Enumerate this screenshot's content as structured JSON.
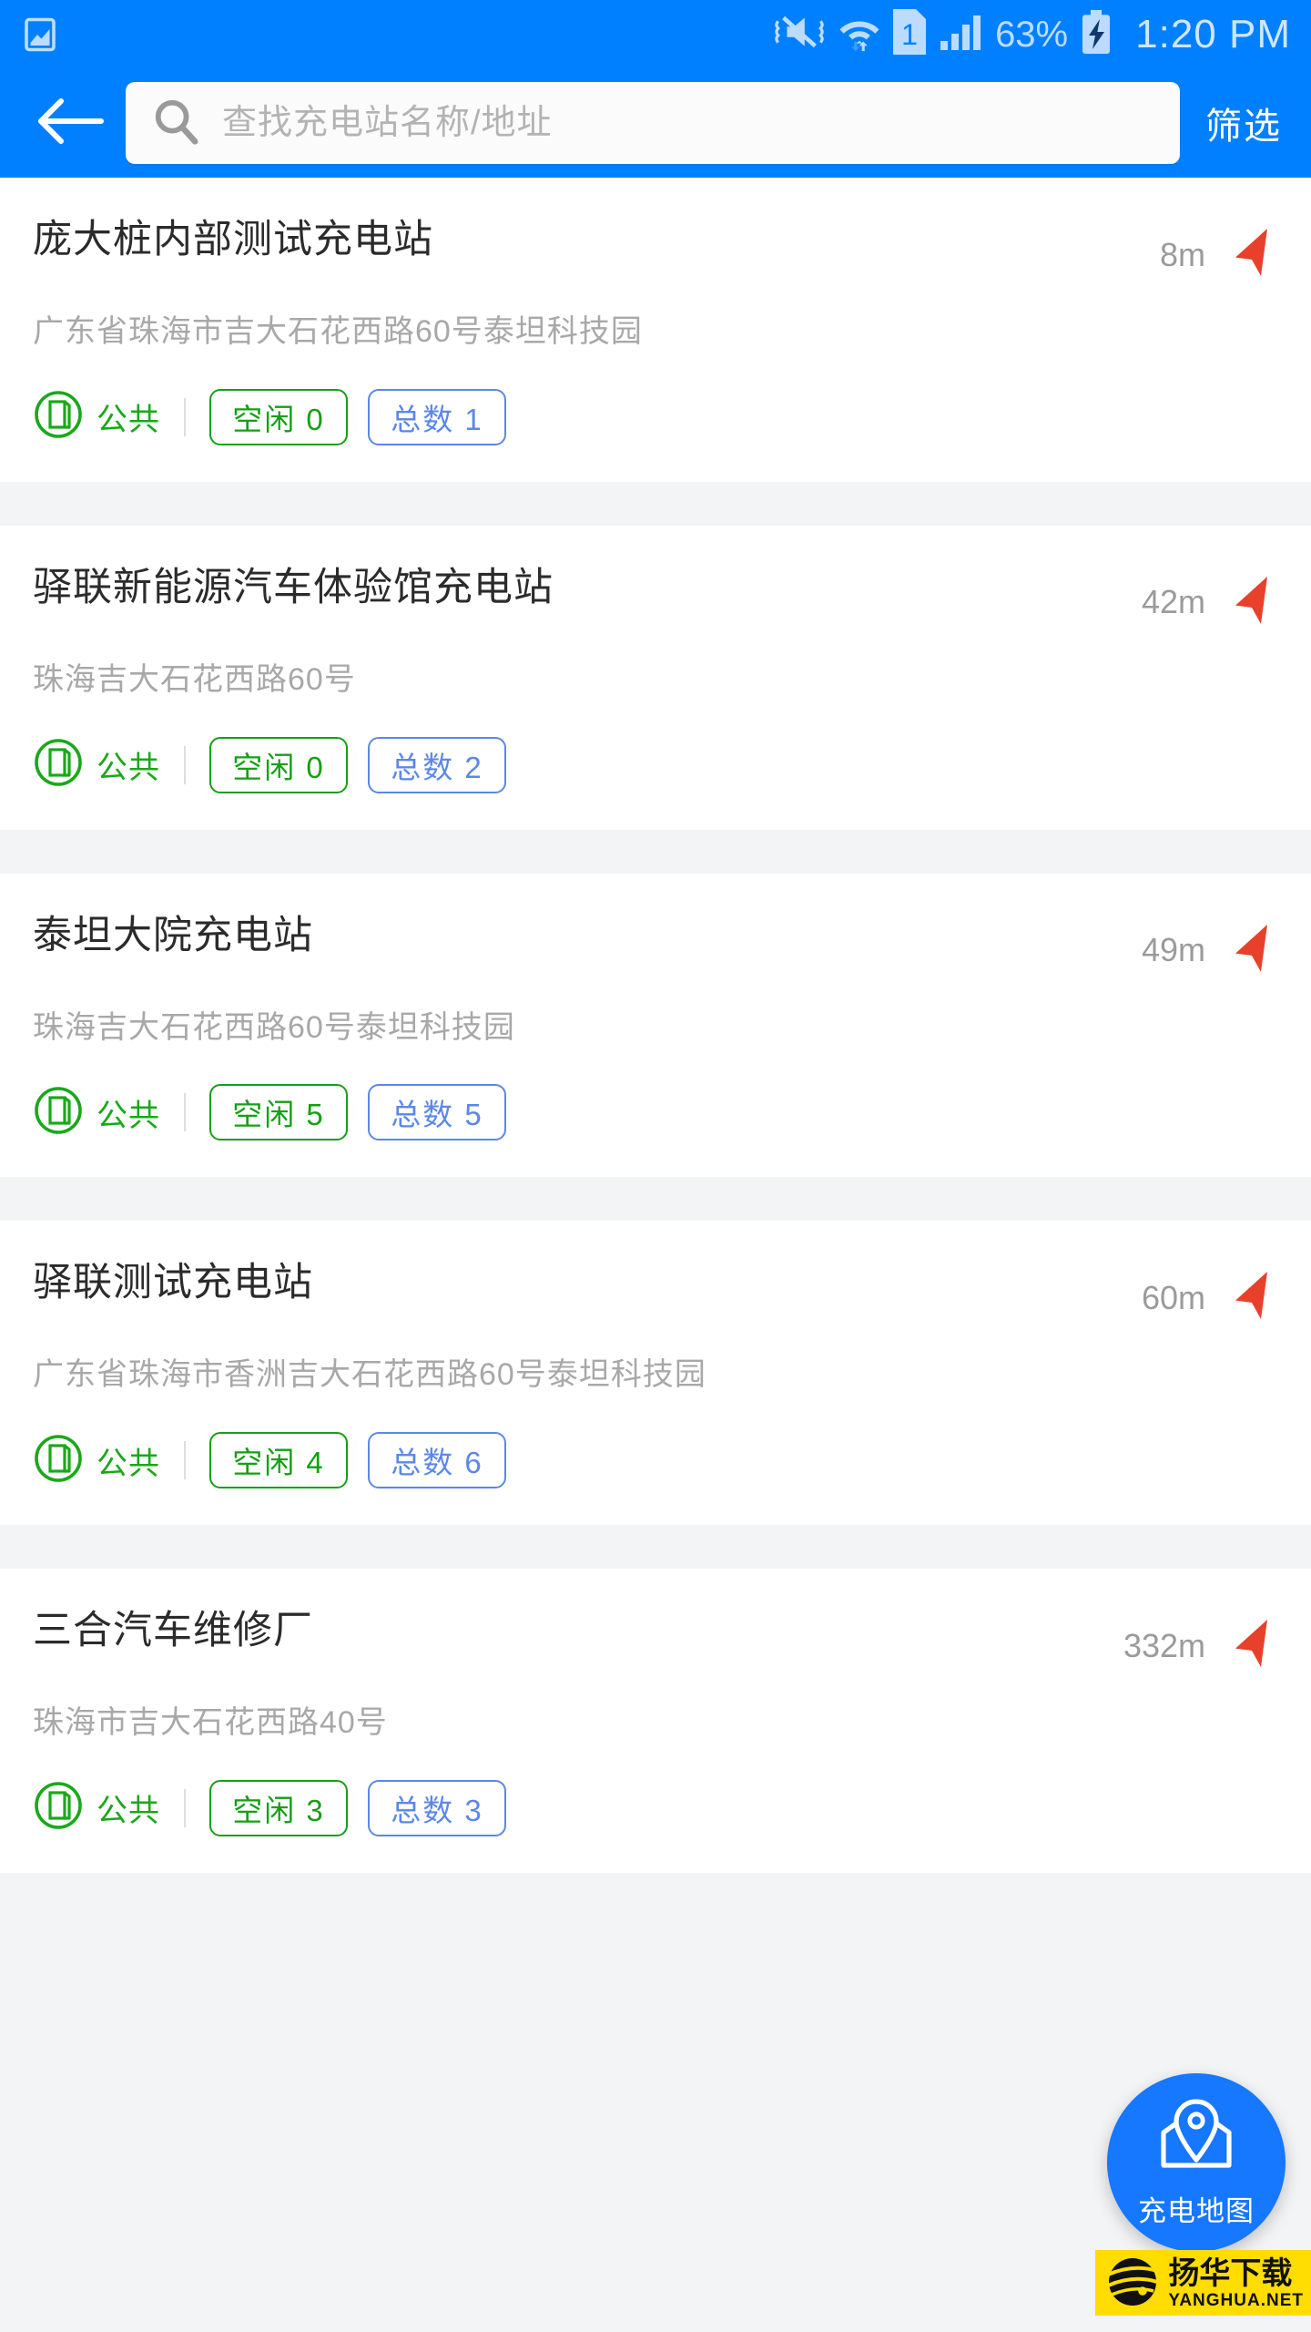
{
  "status_bar": {
    "battery_percent": "63%",
    "clock": "1:20 PM",
    "sim_label": "1",
    "icons": [
      "image-notification-icon",
      "vibrate-mute-icon",
      "wifi-icon",
      "sim-1-icon",
      "cellular-signal-icon",
      "battery-charging-icon"
    ]
  },
  "app_bar": {
    "back_icon": "arrow-left-icon",
    "search_icon": "search-icon",
    "search_value": "",
    "search_placeholder": "查找充电站名称/地址",
    "filter_label": "筛选"
  },
  "colors": {
    "brand_blue": "#0080ff",
    "fab_blue": "#1677ff",
    "green": "#14a014",
    "blue_pill": "#5b87e8",
    "nav_arrow_red": "#e8402a",
    "page_bg": "#f2f4f6",
    "watermark_yellow": "#ffdd00"
  },
  "fab": {
    "icon": "map-pin-icon",
    "label": "充电地图"
  },
  "watermark": {
    "cn": "扬华下载",
    "en": "YANGHUA.NET"
  },
  "stations": [
    {
      "name": "庞大桩内部测试充电站",
      "address": "广东省珠海市吉大石花西路60号泰坦科技园",
      "distance": "8m",
      "public_label": "公共",
      "free_label": "空闲 0",
      "total_label": "总数 1"
    },
    {
      "name": "驿联新能源汽车体验馆充电站",
      "address": "珠海吉大石花西路60号",
      "distance": "42m",
      "public_label": "公共",
      "free_label": "空闲 0",
      "total_label": "总数 2"
    },
    {
      "name": "泰坦大院充电站",
      "address": "珠海吉大石花西路60号泰坦科技园",
      "distance": "49m",
      "public_label": "公共",
      "free_label": "空闲 5",
      "total_label": "总数 5"
    },
    {
      "name": "驿联测试充电站",
      "address": "广东省珠海市香洲吉大石花西路60号泰坦科技园",
      "distance": "60m",
      "public_label": "公共",
      "free_label": "空闲 4",
      "total_label": "总数 6"
    },
    {
      "name": "三合汽车维修厂",
      "address": "珠海市吉大石花西路40号",
      "distance": "332m",
      "public_label": "公共",
      "free_label": "空闲 3",
      "total_label": "总数 3"
    }
  ]
}
